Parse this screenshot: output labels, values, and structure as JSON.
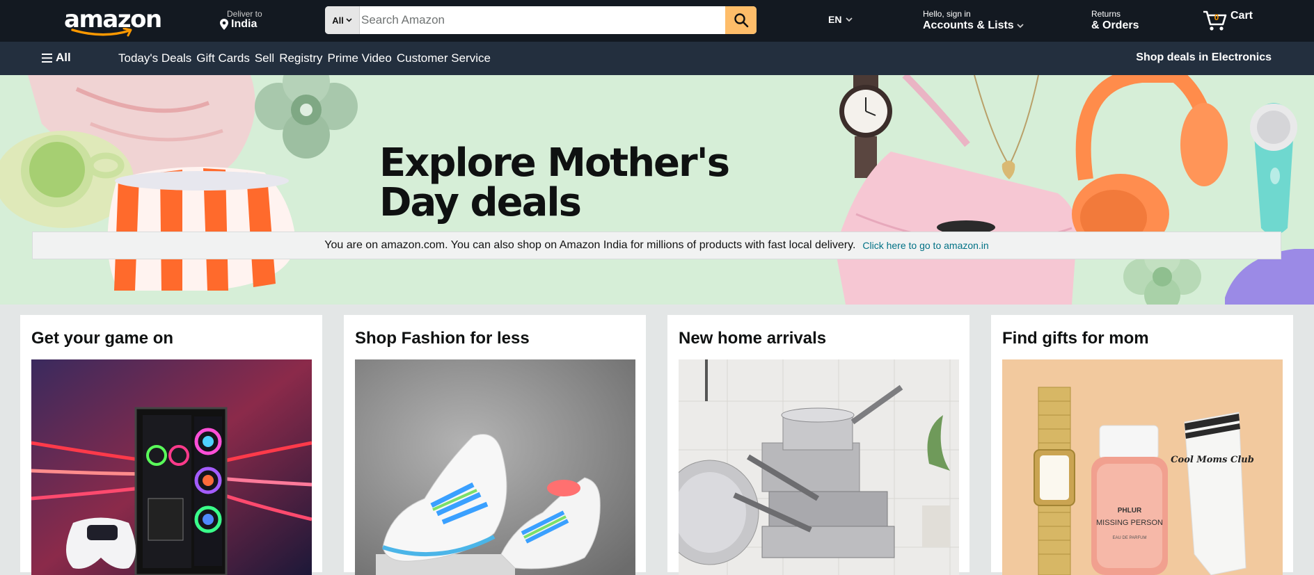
{
  "header": {
    "logo_text": "amazon",
    "deliver_to_label": "Deliver to",
    "deliver_to_location": "India",
    "search": {
      "category": "All",
      "placeholder": "Search Amazon"
    },
    "language": "EN",
    "account_greeting": "Hello, sign in",
    "account_label": "Accounts & Lists",
    "returns_label": "Returns",
    "orders_label": "& Orders",
    "cart_label": "Cart",
    "cart_count": "0"
  },
  "subnav": {
    "all_label": "All",
    "links": [
      "Today's Deals",
      "Gift Cards",
      "Sell",
      "Registry",
      "Prime Video",
      "Customer Service"
    ],
    "promo": "Shop deals in Electronics"
  },
  "hero": {
    "title": "Explore Mother's\nDay deals",
    "notice_text": "You are on amazon.com. You can also shop on Amazon India for millions of products with fast local delivery.",
    "notice_link": "Click here to go to amazon.in"
  },
  "cards": [
    {
      "title": "Get your game on"
    },
    {
      "title": "Shop Fashion for less"
    },
    {
      "title": "New home arrivals"
    },
    {
      "title": "Find gifts for mom"
    }
  ],
  "product_labels": {
    "perfume_brand": "PHLUR",
    "perfume_name": "MISSING PERSON",
    "perfume_type": "EAU DE PARFUM",
    "sock_text": "Cool Moms Club"
  },
  "colors": {
    "nav_dark": "#131921",
    "nav_sub": "#232f3e",
    "search_button": "#febd69",
    "accent_orange": "#ff9900",
    "link": "#007185",
    "hero_bg": "#d6eed7"
  }
}
